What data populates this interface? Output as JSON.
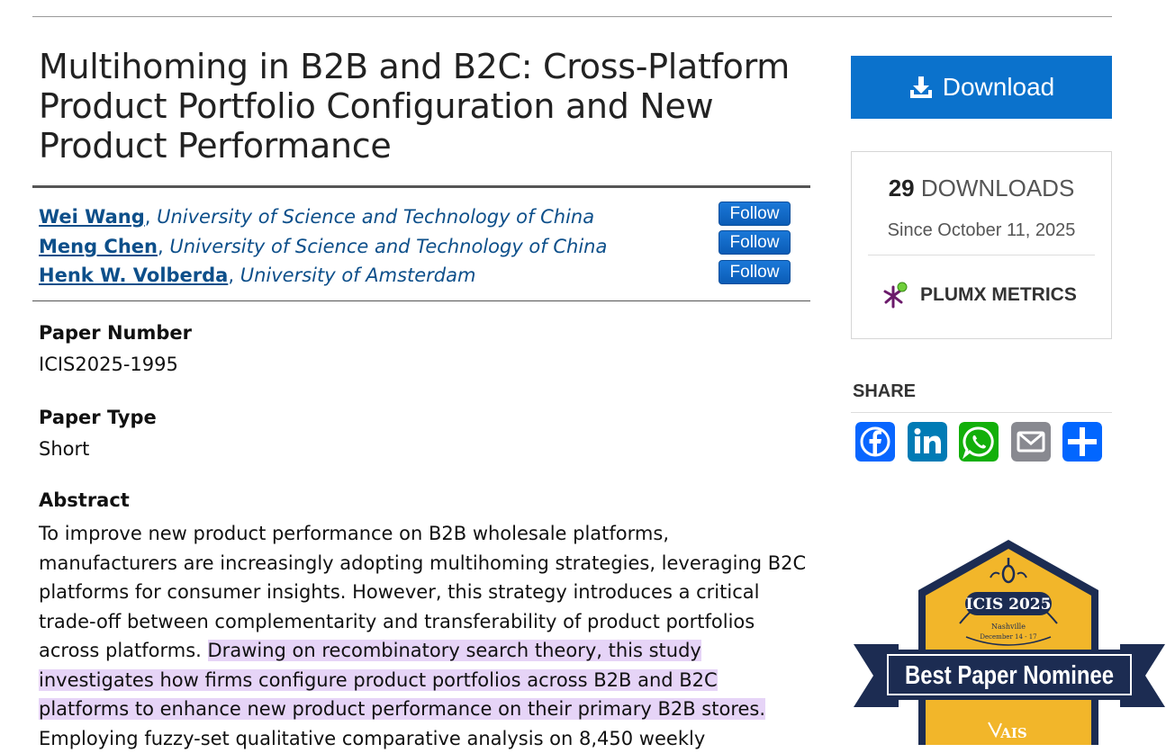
{
  "paper": {
    "title": "Multihoming in B2B and B2C: Cross-Platform Product Portfolio Configuration and New Product Performance"
  },
  "authors": [
    {
      "name": "Wei Wang",
      "institution": "University of Science and Technology of China",
      "follow_label": "Follow"
    },
    {
      "name": "Meng Chen",
      "institution": "University of Science and Technology of China",
      "follow_label": "Follow"
    },
    {
      "name": "Henk W. Volberda",
      "institution": "University of Amsterdam",
      "follow_label": "Follow"
    }
  ],
  "fields": {
    "paper_number_label": "Paper Number",
    "paper_number": "ICIS2025-1995",
    "paper_type_label": "Paper Type",
    "paper_type": "Short",
    "abstract_label": "Abstract",
    "abstract_part1": "To improve new product performance on B2B wholesale platforms, manufacturers are increasingly adopting multihoming strategies, leveraging B2C platforms for consumer insights. However, this strategy introduces a critical trade-off between complementarity and transferability of product portfolios across platforms. ",
    "abstract_highlight": "Drawing on recombinatory search theory, this study investigates how firms configure product portfolios across B2B and B2C platforms to enhance new product performance on their primary B2B stores.",
    "abstract_part2": " Employing fuzzy-set qualitative comparative analysis on 8,450 weekly"
  },
  "sidebar": {
    "download_label": "Download",
    "download_count": "29",
    "downloads_label": "DOWNLOADS",
    "since": "Since October 11, 2025",
    "plumx_label": "PLUMX METRICS",
    "share_label": "SHARE",
    "share_icons": [
      "facebook-icon",
      "linkedin-icon",
      "whatsapp-icon",
      "email-icon",
      "share-icon"
    ]
  },
  "badge": {
    "conference": "ICIS 2025",
    "location": "Nashville",
    "dates": "December 14 - 17",
    "award": "Best Paper Nominee",
    "org": "AIS"
  },
  "colors": {
    "accent": "#0b72cc",
    "link": "#0d4f8a",
    "highlight": "#e6d4f7",
    "badge_gold": "#f2b62a",
    "badge_navy": "#1c2c52"
  }
}
